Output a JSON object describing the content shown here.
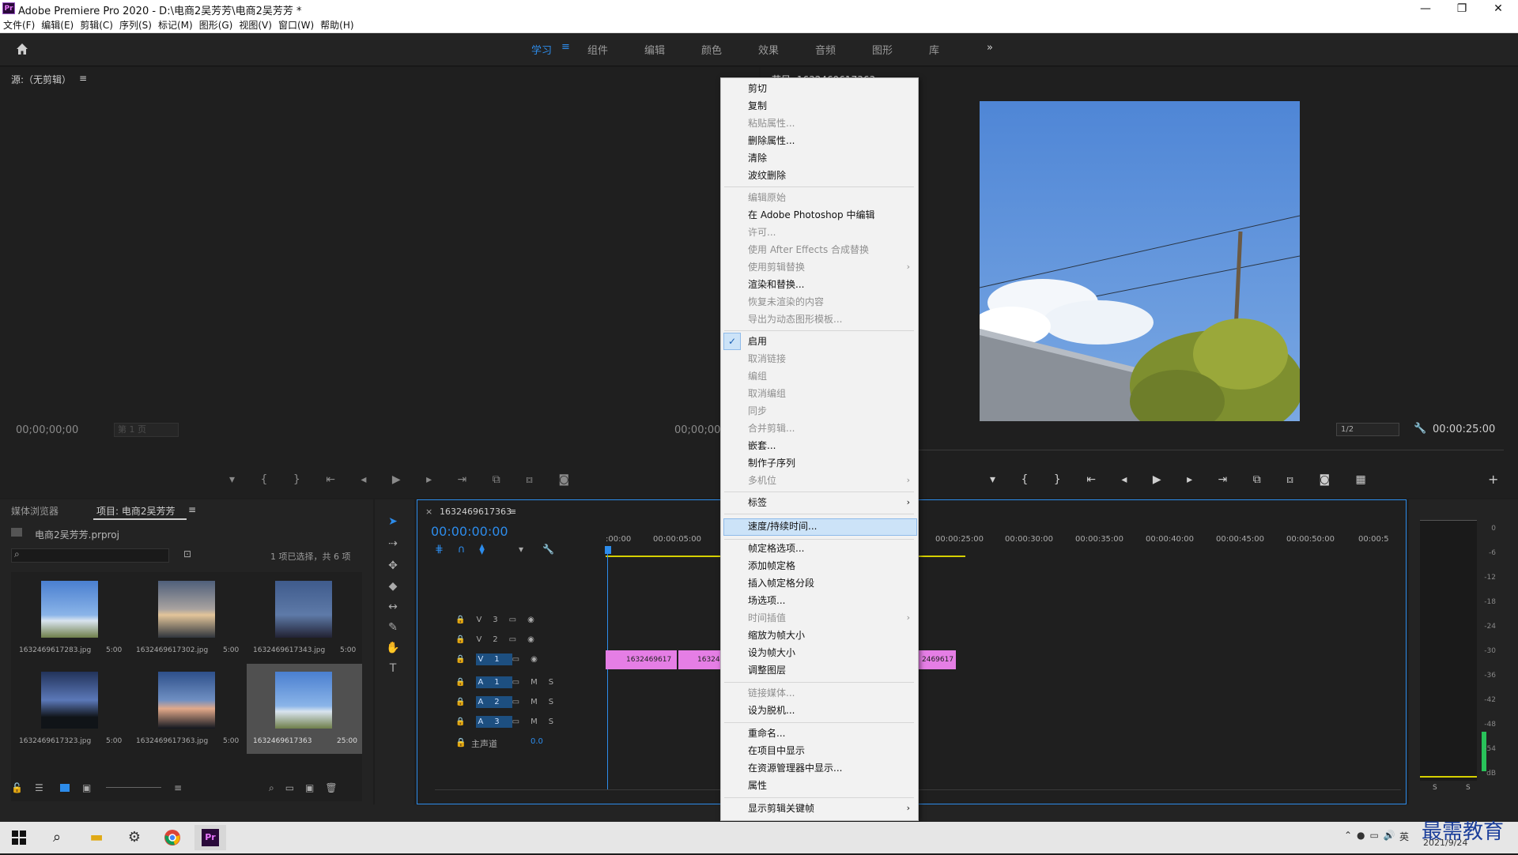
{
  "window": {
    "app_icon": "Pr",
    "title": "Adobe Premiere Pro 2020 - D:\\电商2吴芳芳\\电商2吴芳芳 *",
    "controls": [
      "—",
      "❐",
      "✕"
    ]
  },
  "menubar": [
    "文件(F)",
    "编辑(E)",
    "剪辑(C)",
    "序列(S)",
    "标记(M)",
    "图形(G)",
    "视图(V)",
    "窗口(W)",
    "帮助(H)"
  ],
  "workspaces": [
    "学习",
    "组件",
    "编辑",
    "颜色",
    "效果",
    "音频",
    "图形",
    "库"
  ],
  "workspace_more": "»",
  "source_monitor": {
    "title": "源:（无剪辑）",
    "timecode_left": "00;00;00;00",
    "page": "第 1 页",
    "timecode_right": "00;00;00"
  },
  "program_monitor": {
    "title": "节目: 1632469617363",
    "zoom": "1/2",
    "duration": "00:00:25:00"
  },
  "project_panel": {
    "tab_media": "媒体浏览器",
    "tab_project": "项目: 电商2吴芳芳",
    "file": "电商2吴芳芳.prproj",
    "selection": "1 项已选择，共 6 项",
    "items": [
      {
        "name": "1632469617283.jpg",
        "dur": "5:00"
      },
      {
        "name": "1632469617302.jpg",
        "dur": "5:00"
      },
      {
        "name": "1632469617343.jpg",
        "dur": "5:00"
      },
      {
        "name": "1632469617323.jpg",
        "dur": "5:00"
      },
      {
        "name": "1632469617363.jpg",
        "dur": "5:00"
      },
      {
        "name": "1632469617363",
        "dur": "25:00"
      }
    ]
  },
  "timeline": {
    "sequence": "1632469617363",
    "timecode": "00:00:00:00",
    "ruler": ":00:00",
    "ruler_marks": [
      "00:00:05:00",
      "00:00:25:00",
      "00:00:30:00",
      "00:00:35:00",
      "00:00:40:00",
      "00:00:45:00",
      "00:00:50:00",
      "00:00:5"
    ],
    "tracks_video": [
      "V3",
      "V2",
      "V1"
    ],
    "tracks_audio": [
      "A1",
      "A2",
      "A3"
    ],
    "master": "主声道",
    "master_value": "0.0",
    "clips": [
      "1632469617",
      "16324",
      "2469617"
    ]
  },
  "audio_meter": {
    "scale": [
      "0",
      "-6",
      "-12",
      "-18",
      "-24",
      "-30",
      "-36",
      "-42",
      "-48",
      "-54",
      "dB"
    ],
    "solo": [
      "S",
      "S"
    ]
  },
  "context_menu": {
    "items": [
      {
        "label": "剪切",
        "disabled": false
      },
      {
        "label": "复制",
        "disabled": false
      },
      {
        "label": "粘贴属性...",
        "disabled": true
      },
      {
        "label": "删除属性...",
        "disabled": false
      },
      {
        "label": "清除",
        "disabled": false
      },
      {
        "label": "波纹删除",
        "disabled": false
      },
      {
        "label": "编辑原始",
        "disabled": true
      },
      {
        "label": "在 Adobe Photoshop 中编辑",
        "disabled": false
      },
      {
        "label": "许可...",
        "disabled": true
      },
      {
        "label": "使用 After Effects 合成替换",
        "disabled": true
      },
      {
        "label": "使用剪辑替换",
        "disabled": true
      },
      {
        "label": "渲染和替换...",
        "disabled": false
      },
      {
        "label": "恢复未渲染的内容",
        "disabled": true
      },
      {
        "label": "导出为动态图形模板...",
        "disabled": true
      },
      {
        "label": "启用",
        "disabled": false
      },
      {
        "label": "取消链接",
        "disabled": true
      },
      {
        "label": "编组",
        "disabled": true
      },
      {
        "label": "取消编组",
        "disabled": true
      },
      {
        "label": "同步",
        "disabled": true
      },
      {
        "label": "合并剪辑...",
        "disabled": true
      },
      {
        "label": "嵌套...",
        "disabled": false
      },
      {
        "label": "制作子序列",
        "disabled": false
      },
      {
        "label": "多机位",
        "disabled": true
      },
      {
        "label": "标签",
        "disabled": false
      },
      {
        "label": "速度/持续时间...",
        "disabled": false
      },
      {
        "label": "帧定格选项...",
        "disabled": false
      },
      {
        "label": "添加帧定格",
        "disabled": false
      },
      {
        "label": "插入帧定格分段",
        "disabled": false
      },
      {
        "label": "场选项...",
        "disabled": false
      },
      {
        "label": "时间插值",
        "disabled": true
      },
      {
        "label": "缩放为帧大小",
        "disabled": false
      },
      {
        "label": "设为帧大小",
        "disabled": false
      },
      {
        "label": "调整图层",
        "disabled": false
      },
      {
        "label": "链接媒体...",
        "disabled": true
      },
      {
        "label": "设为脱机...",
        "disabled": false
      },
      {
        "label": "重命名...",
        "disabled": false
      },
      {
        "label": "在项目中显示",
        "disabled": false
      },
      {
        "label": "在资源管理器中显示...",
        "disabled": false
      },
      {
        "label": "属性",
        "disabled": false
      },
      {
        "label": "显示剪辑关键帧",
        "disabled": false
      }
    ],
    "submenu_arrow": "›",
    "checkmark": "✓"
  },
  "taskbar": {
    "ime": "英",
    "date": "2021/9/24",
    "watermark": "最需教育"
  },
  "icons": [
    "home-icon",
    "menu-icon",
    "search-icon",
    "lock-icon",
    "eye-icon",
    "wrench-icon",
    "play-icon",
    "windows-icon",
    "explorer-icon",
    "settings-icon",
    "chrome-icon",
    "premiere-icon"
  ],
  "colors": {
    "accent": "#2d8ceb",
    "clip": "#e57ee5",
    "menu_highlight": "#cce3f8"
  }
}
